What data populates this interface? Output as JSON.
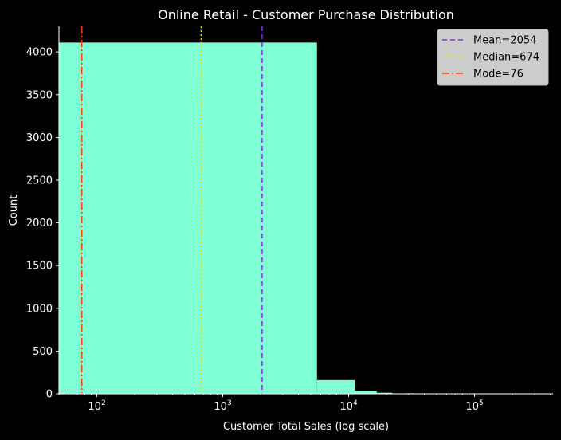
{
  "chart_data": {
    "type": "histogram",
    "title": "Online Retail - Customer Purchase Distribution",
    "xlabel": "Customer Total Sales (log scale)",
    "ylabel": "Count",
    "x_scale": "log",
    "xlim": [
      50,
      420000
    ],
    "ylim": [
      0,
      4300
    ],
    "y_ticks": [
      0,
      500,
      1000,
      1500,
      2000,
      2500,
      3000,
      3500,
      4000
    ],
    "x_ticks": [
      {
        "value": 100,
        "base": "10",
        "exp": "2"
      },
      {
        "value": 1000,
        "base": "10",
        "exp": "3"
      },
      {
        "value": 10000,
        "base": "10",
        "exp": "4"
      },
      {
        "value": 100000,
        "base": "10",
        "exp": "5"
      }
    ],
    "bar_color": "#7fffd4",
    "bins": [
      {
        "x0": 50,
        "x1": 5600,
        "count": 4110
      },
      {
        "x0": 5600,
        "x1": 11150,
        "count": 160
      },
      {
        "x0": 11150,
        "x1": 16700,
        "count": 35
      },
      {
        "x0": 16700,
        "x1": 22250,
        "count": 12
      },
      {
        "x0": 22250,
        "x1": 27800,
        "count": 3
      },
      {
        "x0": 27800,
        "x1": 33350,
        "count": 6
      },
      {
        "x0": 33350,
        "x1": 38900,
        "count": 1
      },
      {
        "x0": 44450,
        "x1": 50000,
        "count": 1
      },
      {
        "x0": 50000,
        "x1": 55550,
        "count": 1
      },
      {
        "x0": 77800,
        "x1": 83350,
        "count": 1
      },
      {
        "x0": 122200,
        "x1": 127750,
        "count": 1
      },
      {
        "x0": 183300,
        "x1": 188850,
        "count": 1
      },
      {
        "x0": 277600,
        "x1": 283150,
        "count": 1
      }
    ],
    "reference_lines": [
      {
        "name": "Mean=2054",
        "value": 2054,
        "color": "#8a2be2",
        "dash": "6,4"
      },
      {
        "name": "Median=674",
        "value": 674,
        "color": "#ffd700",
        "dash": "2,3"
      },
      {
        "name": "Mode=76",
        "value": 76,
        "color": "#ff4500",
        "dash": "9,3,2,3"
      }
    ],
    "legend_position": "top-right"
  }
}
